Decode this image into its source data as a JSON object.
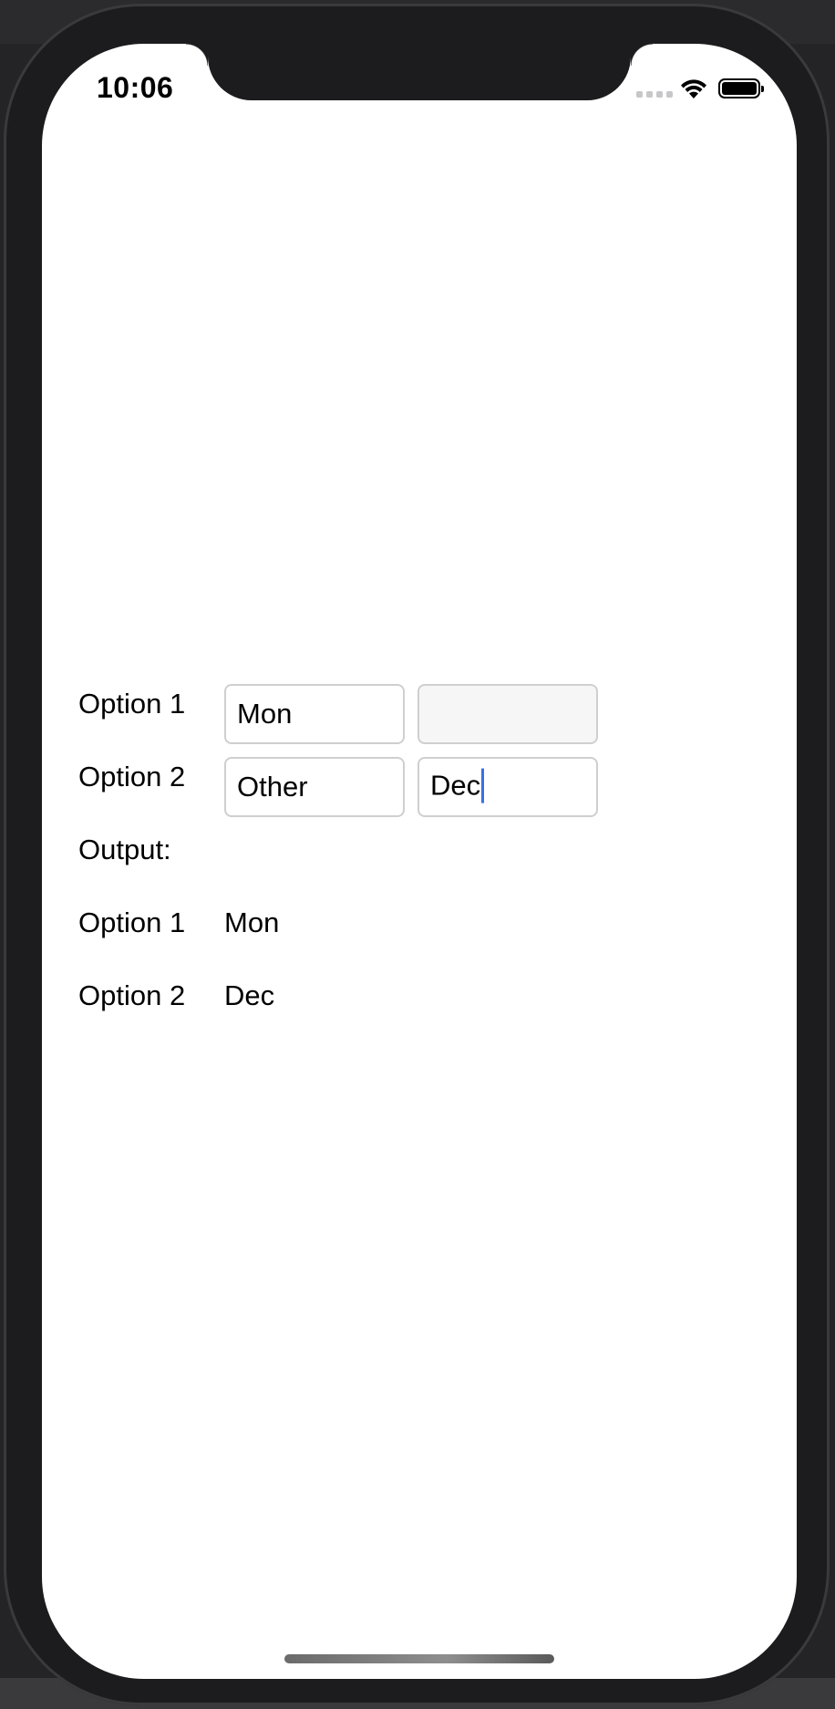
{
  "status_bar": {
    "time": "10:06",
    "icons": [
      "cellular-signal-icon",
      "wifi-icon",
      "battery-icon"
    ]
  },
  "form": {
    "row1": {
      "label": "Option 1",
      "field_a": {
        "value": "Mon",
        "placeholder": ""
      },
      "field_b": {
        "value": "",
        "placeholder": ""
      }
    },
    "row2": {
      "label": "Option 2",
      "field_a": {
        "value": "Other",
        "placeholder": ""
      },
      "field_b": {
        "value": "Dec",
        "placeholder": ""
      }
    }
  },
  "output": {
    "heading": "Output:",
    "rows": [
      {
        "label": "Option 1",
        "value": "Mon"
      },
      {
        "label": "Option 2",
        "value": "Dec"
      }
    ]
  },
  "colors": {
    "caret": "#3a6fe6",
    "field_border": "#cfcfcf",
    "disabled_field_bg": "#f6f6f6"
  }
}
